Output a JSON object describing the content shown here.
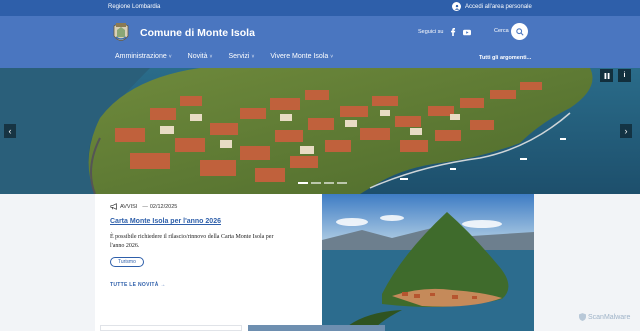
{
  "topbar": {
    "region": "Regione Lombardia",
    "login": "Accedi all'area personale"
  },
  "header": {
    "title": "Comune di Monte Isola",
    "social_label": "Seguici su",
    "search_label": "Cerca"
  },
  "nav": {
    "items": [
      {
        "label": "Amministrazione"
      },
      {
        "label": "Novità"
      },
      {
        "label": "Servizi"
      },
      {
        "label": "Vivere Monte Isola"
      }
    ],
    "all_topics": "Tutti gli argomenti..."
  },
  "hero": {
    "pause_icon": "pause-icon",
    "info_label": "i"
  },
  "news": {
    "category": "AVVISI",
    "date": "02/12/2025",
    "title": "Carta Monte Isola per l'anno 2026",
    "body": "È possibile richiedere il rilascio/rinnovo della Carta Monte Isola per l'anno 2026.",
    "tag": "Turismo",
    "all_news": "TUTTE LE NOVITÀ"
  },
  "watermark": "ScanMalware",
  "colors": {
    "topbar": "#2e5faa",
    "header": "#4a76c0",
    "link": "#2e5faa"
  }
}
